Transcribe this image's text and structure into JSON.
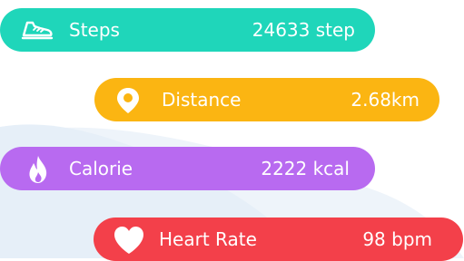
{
  "colors": {
    "steps": "#1fd6ba",
    "distance": "#fbb512",
    "calorie": "#b86af0",
    "heart_rate": "#f3404a",
    "wave": "#eaf1f9"
  },
  "stats": [
    {
      "id": "steps",
      "label": "Steps",
      "value": "24633 step",
      "icon": "sneaker-icon"
    },
    {
      "id": "distance",
      "label": "Distance",
      "value": "2.68km",
      "icon": "location-pin-icon"
    },
    {
      "id": "calorie",
      "label": "Calorie",
      "value": "2222 kcal",
      "icon": "flame-icon"
    },
    {
      "id": "heart_rate",
      "label": "Heart Rate",
      "value": "98 bpm",
      "icon": "heart-icon"
    }
  ]
}
